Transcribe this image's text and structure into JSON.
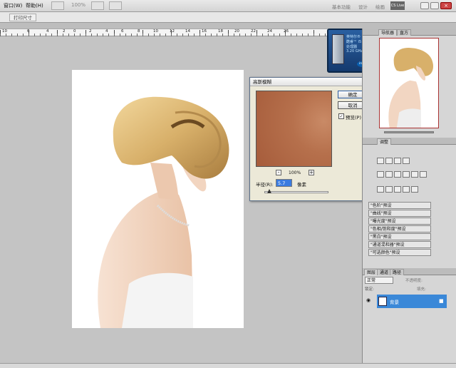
{
  "menubar": {
    "window": "窗口(W)",
    "help": "帮助(H)",
    "zoom": "100%",
    "workspaces": [
      "基本功能",
      "设计",
      "绘画"
    ],
    "active_workspace": "CS Live"
  },
  "options": {
    "print_size": "打印尺寸"
  },
  "ruler": {
    "labels": [
      "10",
      "6",
      "4",
      "2",
      "0",
      "2",
      "4",
      "6",
      "8",
      "10",
      "12",
      "14",
      "16",
      "18",
      "20",
      "22",
      "24",
      "26"
    ]
  },
  "cpu_widget": {
    "lines": [
      "英特尔®",
      "酷睿™ i5",
      "处理器",
      "3.20 GHz"
    ],
    "brand": "intel"
  },
  "dialog": {
    "title": "高斯模糊",
    "ok": "确定",
    "cancel": "取消",
    "preview_label": "预览(P)",
    "zoom": "100%",
    "radius_label": "半径(R):",
    "radius_value": "5.7",
    "unit": "像素"
  },
  "panels": {
    "nav_tabs": [
      "导航器",
      "直方"
    ],
    "adj_tab": "调整",
    "presets": [
      "\"色阶\"预设",
      "\"曲线\"预设",
      "\"曝光度\"预设",
      "\"色相/饱和度\"预设",
      "\"黑白\"预设",
      "\"通道混和器\"预设",
      "\"可选颜色\"预设"
    ],
    "layer_tabs": [
      "图层",
      "通道",
      "路径"
    ],
    "blend_mode": "正常",
    "opacity_label": "不透明度:",
    "fill_label": "填充:",
    "lock_label": "锁定:",
    "layer_name": "背景"
  }
}
